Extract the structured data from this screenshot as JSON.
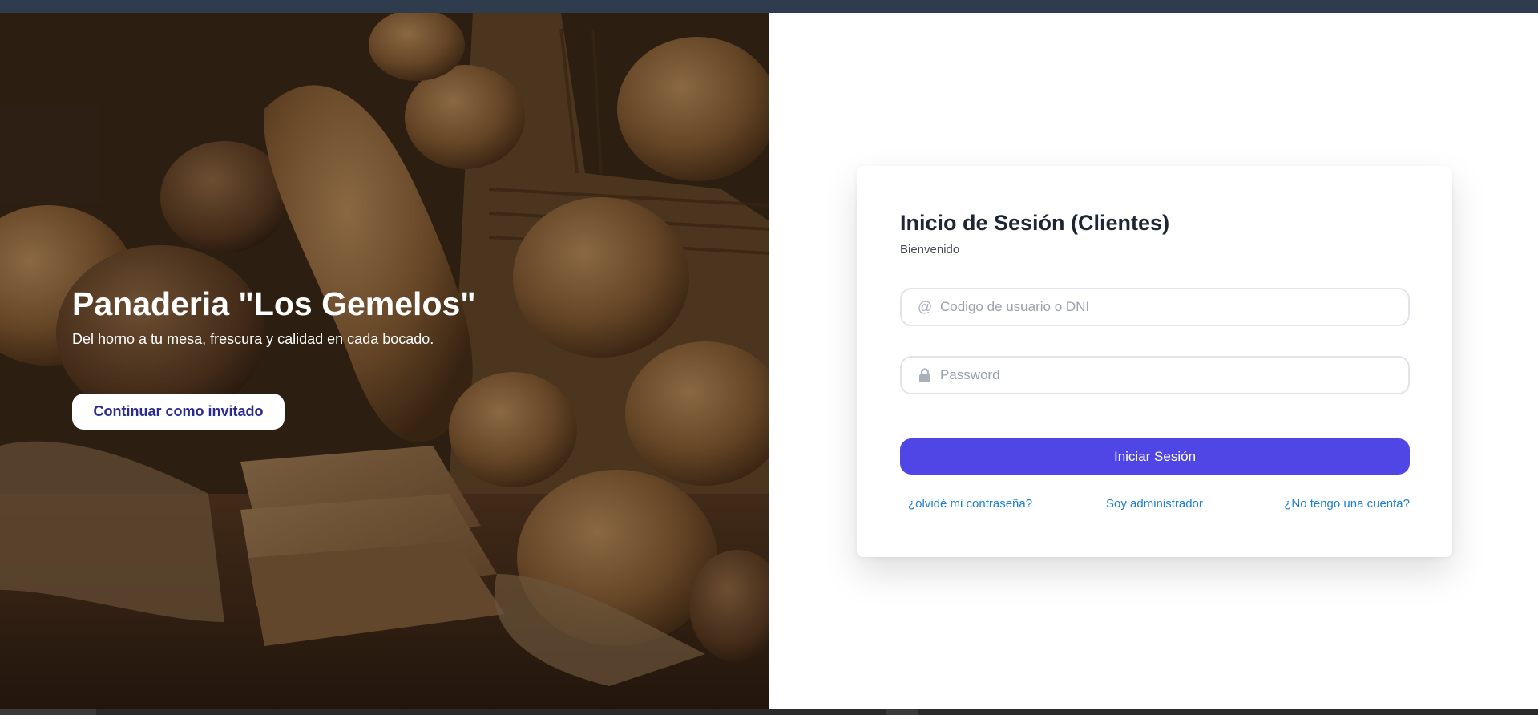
{
  "hero": {
    "title": "Panaderia \"Los Gemelos\"",
    "subtitle": "Del horno a tu mesa, frescura y calidad en cada bocado.",
    "guest_button": "Continuar como invitado"
  },
  "login": {
    "title": "Inicio de Sesión (Clientes)",
    "subtitle": "Bienvenido",
    "user_field": {
      "placeholder": "Codigo de usuario o DNI",
      "value": "",
      "icon": "at-icon"
    },
    "password_field": {
      "placeholder": "Password",
      "value": "",
      "icon": "lock-icon"
    },
    "submit_label": "Iniciar Sesión",
    "links": {
      "forgot_password": "¿olvidé mi contraseña?",
      "admin": "Soy administrador",
      "no_account": "¿No tengo una cuenta?"
    }
  },
  "colors": {
    "primary": "#4f46e5",
    "link": "#1a7fd6",
    "guest_text": "#2b2a8f",
    "topbar": "#2e3c4e"
  }
}
